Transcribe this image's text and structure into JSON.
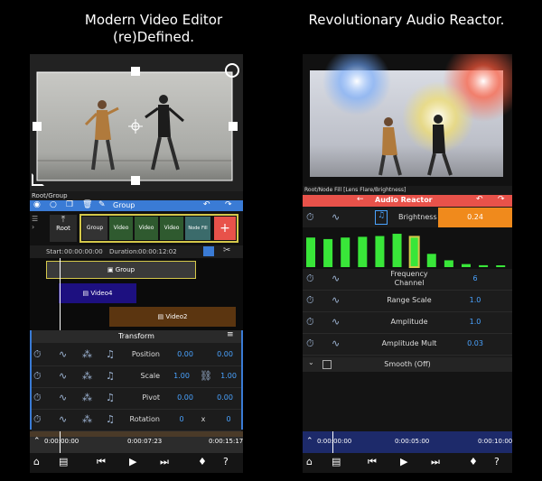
{
  "left_caption": {
    "line1": "Modern Video Editor",
    "line2": "(re)Defined."
  },
  "right_caption": {
    "line1": "Revolutionary Audio Reactor."
  },
  "left": {
    "node_path": "Root/Group",
    "toolbar": {
      "group_label": "Group"
    },
    "root_node_label": "Root",
    "node_tiles": [
      "Group",
      "Video",
      "Video",
      "Video",
      "Node Fill"
    ],
    "start_label": "Start:",
    "start_value": "00:00:00:00",
    "duration_label": "Duration:",
    "duration_value": "00:00:12:02",
    "tracks": [
      "Group",
      "Video4",
      "Video2"
    ],
    "panel_title": "Transform",
    "properties": [
      {
        "name": "Position",
        "v1": "0.00",
        "v2": "0.00"
      },
      {
        "name": "Scale",
        "v1": "1.00",
        "v2": "1.00"
      },
      {
        "name": "Pivot",
        "v1": "0.00",
        "v2": "0.00"
      },
      {
        "name": "Rotation",
        "v1": "0",
        "sep": "x",
        "v2": "0"
      }
    ],
    "timeline": {
      "t0": "0:00:00:00",
      "t1": "0:00:07:23",
      "t2": "0:00:15:17"
    }
  },
  "right": {
    "node_path": "Root/Node Fill [Lens Flare/Brightness]",
    "title": "Audio Reactor",
    "brightness_label": "Brightness",
    "brightness_value": "0.24",
    "bars": [
      0.78,
      0.74,
      0.78,
      0.8,
      0.82,
      0.88,
      0.8,
      0.35,
      0.18,
      0.08,
      0.05,
      0.04
    ],
    "properties": [
      {
        "name": "Frequency Channel",
        "value": "6"
      },
      {
        "name": "Range Scale",
        "value": "1.0"
      },
      {
        "name": "Amplitude",
        "value": "1.0"
      },
      {
        "name": "Amplitude Mult",
        "value": "0.03"
      }
    ],
    "smooth_label": "Smooth (Off)",
    "timeline": {
      "t0": "0:00:00:00",
      "t1": "0:00:05:00",
      "t2": "0:00:10:00"
    }
  },
  "colors": {
    "accent_blue": "#3a7bd5",
    "audio_red": "#e8524a",
    "orange": "#f08a1c",
    "bar_green": "#39e639",
    "group_yellow": "#d4c84a"
  }
}
